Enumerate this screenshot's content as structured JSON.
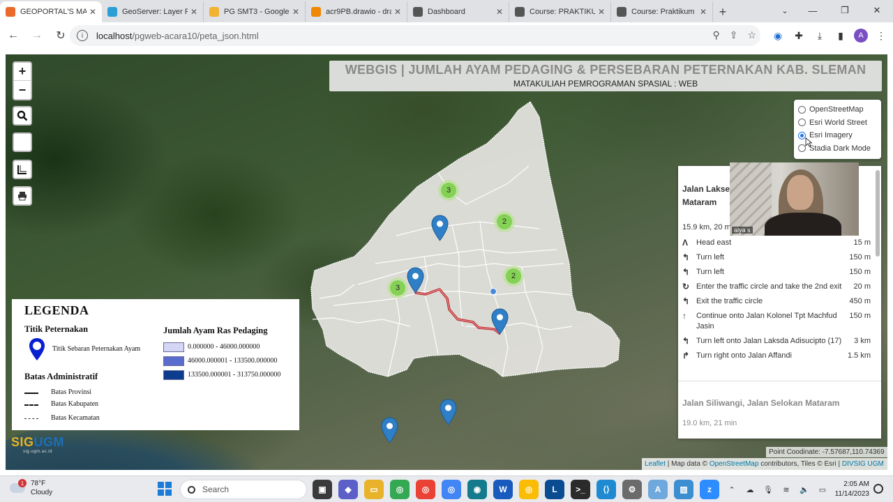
{
  "browser": {
    "tabs": [
      {
        "title": "GEOPORTAL'S MAP",
        "color": "#e96a2a",
        "active": true
      },
      {
        "title": "GeoServer: Layer P",
        "color": "#2b9fd6"
      },
      {
        "title": "PG SMT3 - Google",
        "color": "#f2b233"
      },
      {
        "title": "acr9PB.drawio - dra",
        "color": "#f08705"
      },
      {
        "title": "Dashboard",
        "color": "#555555"
      },
      {
        "title": "Course: PRAKTIKUM",
        "color": "#555555"
      },
      {
        "title": "Course: Praktikum",
        "color": "#555555"
      }
    ],
    "url_host": "localhost",
    "url_path": "/pgweb-acara10/peta_json.html",
    "avatar_letter": "A"
  },
  "map": {
    "title": "WEBGIS | JUMLAH AYAM PEDAGING & PERSEBARAN PETERNAKAN KAB. SLEMAN",
    "subtitle": "MATAKULIAH PEMROGRAMAN SPASIAL : WEB",
    "zoom_in": "+",
    "zoom_out": "−",
    "layers": [
      {
        "label": "OpenStreetMap",
        "checked": false
      },
      {
        "label": "Esri World Street",
        "checked": false
      },
      {
        "label": "Esri Imagery",
        "checked": true
      },
      {
        "label": "Stadia Dark Mode",
        "checked": false
      }
    ],
    "clusters": [
      "3",
      "2",
      "3",
      "2"
    ],
    "coord_label": "Point Coodinate: -7.57687,110.74369",
    "attribution": {
      "leaflet": "Leaflet",
      "mid": " | Map data © ",
      "osm": "OpenStreetMap",
      "tiles": " contributors, Tiles © Esri | ",
      "divsig": "DIVSIG UGM"
    },
    "region_color": "#e3e1dd",
    "route_color": "#c0282d",
    "marker_color": "#2f7fc7"
  },
  "routing": {
    "route_name": "Jalan Laksda Adisucipto, Jalan Selokan Mataram",
    "route_name_visible_1": "Jalan Lakse",
    "route_name_visible_2": "Mataram",
    "route_dist": "15.9 km, 20 m",
    "instructions": [
      {
        "icon": "Λ",
        "text": "Head east",
        "dist": "15 m"
      },
      {
        "icon": "↰",
        "text": "Turn left",
        "dist": "150 m"
      },
      {
        "icon": "↰",
        "text": "Turn left",
        "dist": "150 m"
      },
      {
        "icon": "↻",
        "text": "Enter the traffic circle and take the 2nd exit",
        "dist": "20 m"
      },
      {
        "icon": "↰",
        "text": "Exit the traffic circle",
        "dist": "450 m"
      },
      {
        "icon": "↑",
        "text": "Continue onto Jalan Kolonel Tpt Machfud Jasin",
        "dist": "150 m"
      },
      {
        "icon": "↰",
        "text": "Turn left onto Jalan Laksda Adisucipto (17)",
        "dist": "3 km"
      },
      {
        "icon": "↱",
        "text": "Turn right onto Jalan Affandi",
        "dist": "1.5 km"
      }
    ],
    "alt_name": "Jalan Siliwangi, Jalan Selokan Mataram",
    "alt_dist": "19.0 km, 21 min",
    "webcam_name": "alya s"
  },
  "legend": {
    "title": "LEGENDA",
    "titik_heading": "Titik Peternakan",
    "titik_label": "Titik Sebaran Peternakan Ayam",
    "batas_heading": "Batas Administratif",
    "batas_items": [
      "Batas Provinsi",
      "Batas Kabupaten",
      "Batas Kecamatan"
    ],
    "jumlah_heading": "Jumlah Ayam Ras Pedaging",
    "classes": [
      {
        "label": "0.000000 - 46000.000000",
        "color": "#d5d6f6"
      },
      {
        "label": "46000.000001 - 133500.000000",
        "color": "#5a6ccd"
      },
      {
        "label": "133500.000001 - 313750.000000",
        "color": "#0b3c8e"
      }
    ]
  },
  "logo": {
    "sig": "SIG",
    "ugm": "UGM",
    "small": "sig.ugm.ac.id"
  },
  "taskbar": {
    "temp": "78°F",
    "condition": "Cloudy",
    "weather_badge": "1",
    "search": "Search",
    "time": "2:05 AM",
    "date": "11/14/2023"
  }
}
